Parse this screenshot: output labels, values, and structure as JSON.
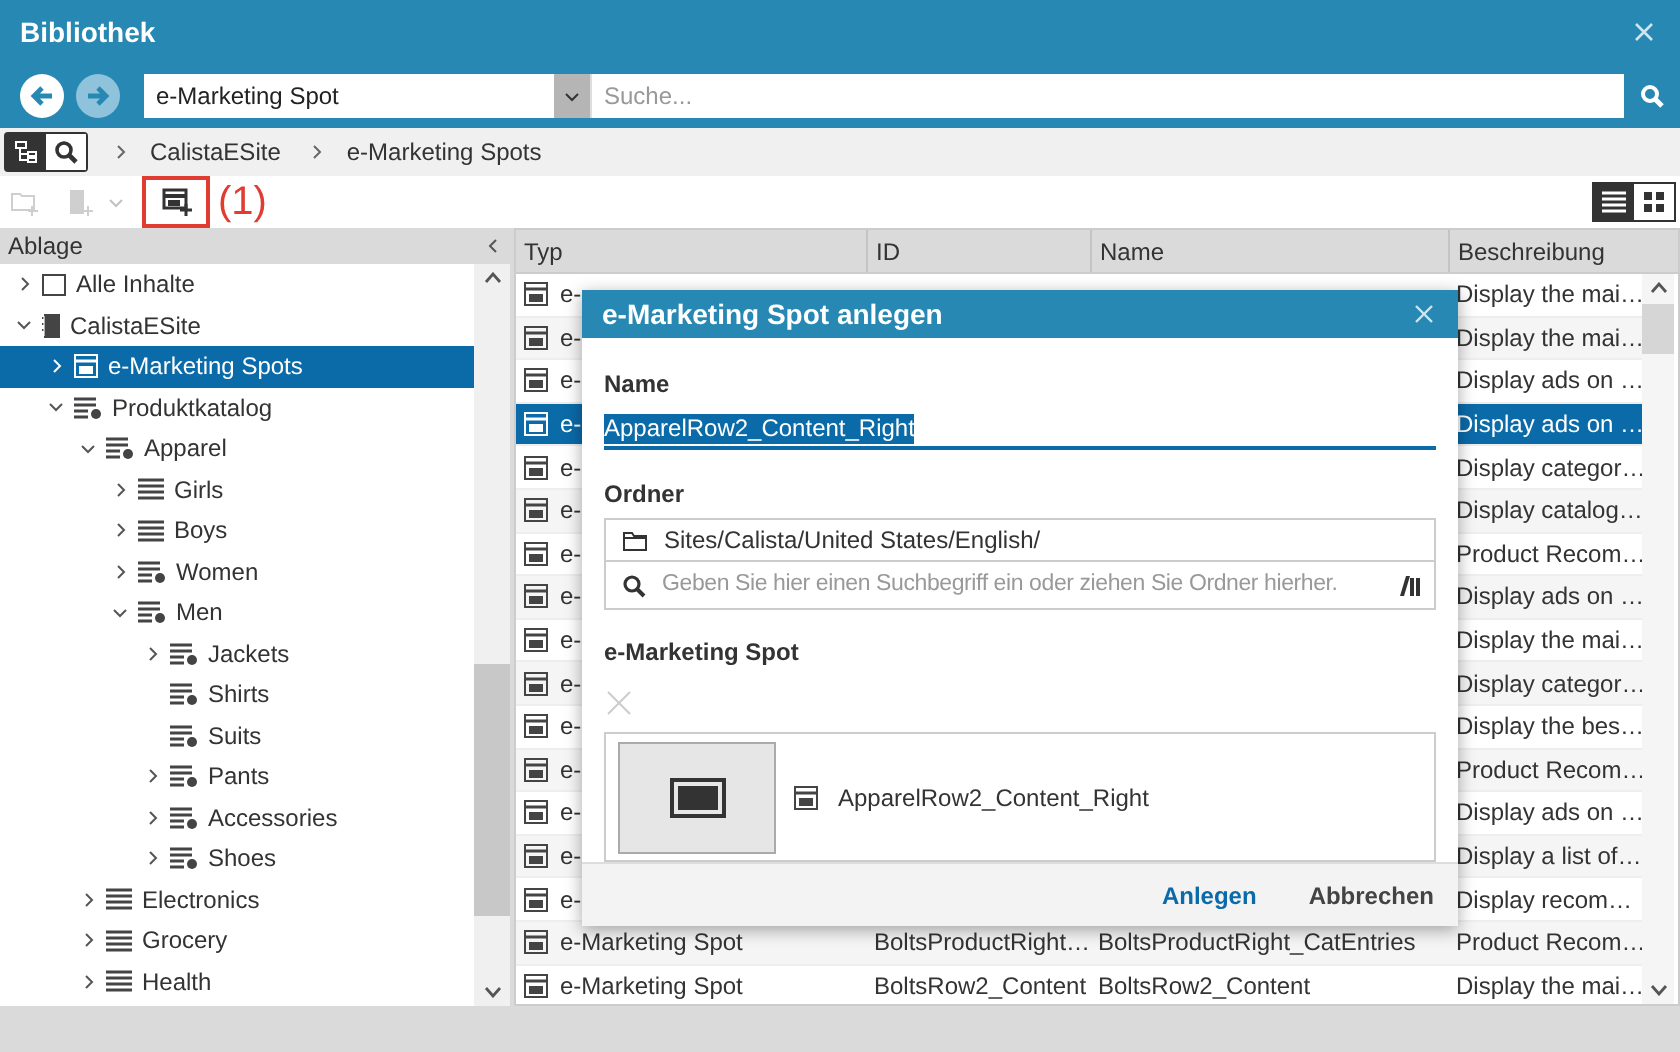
{
  "window": {
    "title": "Bibliothek"
  },
  "nav": {
    "type_select": "e-Marketing Spot",
    "search_placeholder": "Suche..."
  },
  "breadcrumb": [
    "CalistaESite",
    "e-Marketing Spots"
  ],
  "toolbar": {
    "annotation": "(1)",
    "view_modes": [
      {
        "kind": "list",
        "selected": true
      },
      {
        "kind": "grid",
        "selected": false
      }
    ]
  },
  "sidebar": {
    "title": "Ablage",
    "tree": [
      {
        "label": "Alle Inhalte",
        "kind": "folder",
        "expanded": false,
        "selected": false
      },
      {
        "label": "CalistaESite",
        "kind": "site",
        "expanded": true,
        "selected": false,
        "children": [
          {
            "label": "e-Marketing Spots",
            "kind": "spot",
            "expanded": false,
            "selected": true
          },
          {
            "label": "Produktkatalog",
            "kind": "catalog",
            "expanded": true,
            "selected": false,
            "children": [
              {
                "label": "Apparel",
                "kind": "catalog",
                "expanded": true,
                "selected": false,
                "children": [
                  {
                    "label": "Girls",
                    "kind": "category",
                    "expanded": false,
                    "selected": false
                  },
                  {
                    "label": "Boys",
                    "kind": "category",
                    "expanded": false,
                    "selected": false
                  },
                  {
                    "label": "Women",
                    "kind": "catalog",
                    "expanded": false,
                    "selected": false
                  },
                  {
                    "label": "Men",
                    "kind": "catalog",
                    "expanded": true,
                    "selected": false,
                    "children": [
                      {
                        "label": "Jackets",
                        "kind": "catalog",
                        "expanded": false,
                        "selected": false
                      },
                      {
                        "label": "Shirts",
                        "kind": "catalog",
                        "selected": false
                      },
                      {
                        "label": "Suits",
                        "kind": "catalog",
                        "selected": false
                      },
                      {
                        "label": "Pants",
                        "kind": "catalog",
                        "expanded": false,
                        "selected": false
                      },
                      {
                        "label": "Accessories",
                        "kind": "catalog",
                        "expanded": false,
                        "selected": false
                      },
                      {
                        "label": "Shoes",
                        "kind": "catalog",
                        "expanded": false,
                        "selected": false
                      }
                    ]
                  }
                ]
              },
              {
                "label": "Electronics",
                "kind": "category",
                "expanded": false,
                "selected": false
              },
              {
                "label": "Grocery",
                "kind": "category",
                "expanded": false,
                "selected": false
              },
              {
                "label": "Health",
                "kind": "category",
                "expanded": false,
                "selected": false
              }
            ]
          }
        ]
      }
    ]
  },
  "table": {
    "columns": [
      "Typ",
      "ID",
      "Name",
      "Beschreibung"
    ],
    "rows": [
      {
        "typ": "e-",
        "description": "Display the mai…",
        "selected": false
      },
      {
        "typ": "e-",
        "description": "Display the mai…",
        "selected": false
      },
      {
        "typ": "e-",
        "description": "Display ads on …",
        "selected": false
      },
      {
        "typ": "e-",
        "description": "Display ads on …",
        "selected": true
      },
      {
        "typ": "e-",
        "description": "Display categor…",
        "selected": false
      },
      {
        "typ": "e-",
        "description": "Display catalog…",
        "selected": false
      },
      {
        "typ": "e-",
        "description": "Product Recom…",
        "selected": false
      },
      {
        "typ": "e-",
        "description": "Display ads on …",
        "selected": false
      },
      {
        "typ": "e-",
        "description": "Display the mai…",
        "selected": false
      },
      {
        "typ": "e-",
        "description": "Display categor…",
        "selected": false
      },
      {
        "typ": "e-",
        "description": "Display the bes…",
        "selected": false
      },
      {
        "typ": "e-",
        "description": "Product Recom…",
        "selected": false
      },
      {
        "typ": "e-",
        "description": "Display ads on …",
        "selected": false
      },
      {
        "typ": "e-",
        "description": "Display a list of…",
        "selected": false
      },
      {
        "typ": "e-",
        "description": "Display recom…",
        "selected": false
      },
      {
        "typ": "e-Marketing Spot",
        "id": "BoltsProductRight…",
        "name": "BoltsProductRight_CatEntries",
        "description": "Product Recom…",
        "selected": false
      },
      {
        "typ": "e-Marketing Spot",
        "id": "BoltsRow2_Content",
        "name": "BoltsRow2_Content",
        "description": "Display the mai…",
        "selected": false
      }
    ]
  },
  "dialog": {
    "title": "e-Marketing Spot anlegen",
    "name_label": "Name",
    "name_value": "ApparelRow2_Content_Right",
    "folder_label": "Ordner",
    "folder_path": "Sites/Calista/United States/English/",
    "folder_search_placeholder": "Geben Sie hier einen Suchbegriff ein oder ziehen Sie Ordner hierher.",
    "spot_label": "e-Marketing Spot",
    "spot_item": "ApparelRow2_Content_Right",
    "buttons": [
      {
        "label": "Anlegen",
        "kind": "primary"
      },
      {
        "label": "Abbrechen",
        "kind": "secondary"
      }
    ]
  }
}
